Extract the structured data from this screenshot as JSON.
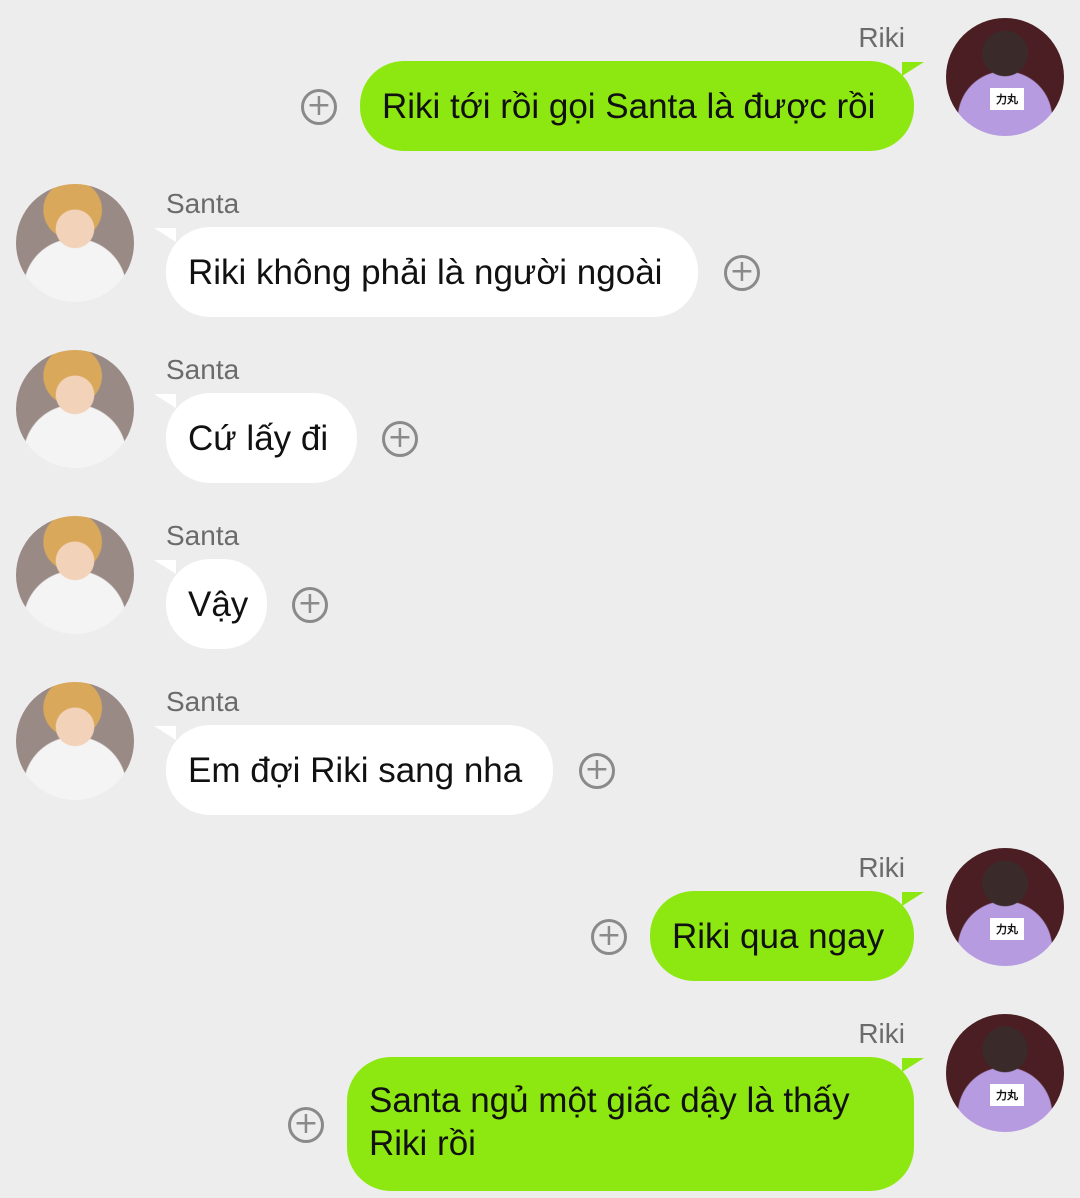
{
  "messages": [
    {
      "sender": "Riki",
      "text": "Riki tới rồi gọi Santa là được rồi"
    },
    {
      "sender": "Santa",
      "text": "Riki không phải là người ngoài"
    },
    {
      "sender": "Santa",
      "text": "Cứ lấy đi"
    },
    {
      "sender": "Santa",
      "text": "Vậy"
    },
    {
      "sender": "Santa",
      "text": "Em đợi Riki sang nha"
    },
    {
      "sender": "Riki",
      "text": "Riki qua ngay"
    },
    {
      "sender": "Riki",
      "text": "Santa ngủ một giấc dậy là thấy Riki rồi"
    }
  ],
  "avatar_badge": "力丸",
  "add_icon": "plus-circle-icon",
  "colors": {
    "background": "#ededed",
    "outgoing_bubble": "#8de812",
    "incoming_bubble": "#ffffff"
  }
}
